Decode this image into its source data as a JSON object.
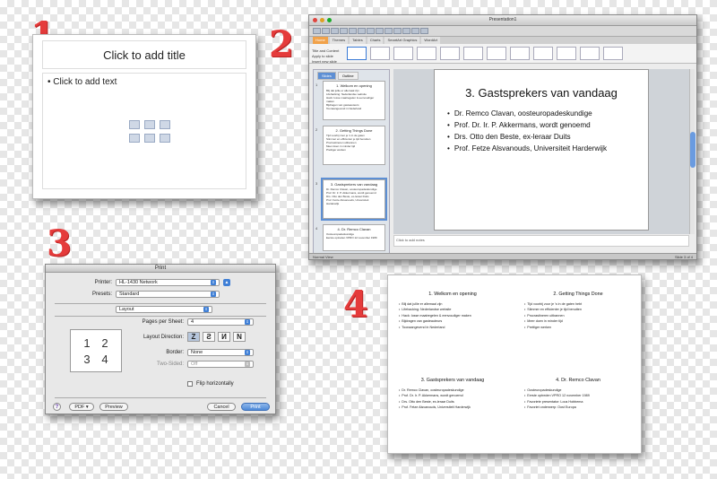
{
  "steps": [
    "1",
    "2",
    "3",
    "4"
  ],
  "empty_slide": {
    "title_placeholder": "Click to add title",
    "body_placeholder": "• Click to add text",
    "content_icons": [
      "table-icon",
      "chart-icon",
      "smartart-icon",
      "picture-icon",
      "clipart-icon",
      "media-icon"
    ]
  },
  "ppt_window": {
    "title": "Presentation1",
    "ribbon_tabs": [
      "Home",
      "Themes",
      "Tables",
      "Charts",
      "SmartArt Graphics",
      "WordArt"
    ],
    "ribbon_tag": [
      "Title and Content",
      "Apply to slide",
      "Insert new slide"
    ],
    "side_tabs": [
      "Slides",
      "Outline"
    ],
    "thumbnails": [
      {
        "num": "1",
        "title": "1. Welkom en opening",
        "lines": [
          "Blij dat jullie er allemaal zijn",
          "Lifehacking: Nederlandse website",
          "Hack: losse maatregelen & eenvoudiger maken",
          "Bijdragen van gasteauteurs",
          "Toonaangevend in Nederland"
        ]
      },
      {
        "num": "2",
        "title": "2. Getting Things Done",
        "lines": [
          "Tijd voorbij zoor je 's in de gaten",
          "Stimmer en efficienter je tijd benutten",
          "Procrastineren uitbannen",
          "Meer doen in minder tijd",
          "Prettiger werken"
        ]
      },
      {
        "num": "3",
        "title": "3. Gastsprekers van vandaag",
        "lines": [
          "Dr. Remco Clavan, oosteuropadeskundige",
          "Prof. Dr. Ir. P. Akkermans, wordt genoemd",
          "Drs. Otto den Beste, ex-leraar Duits",
          "Prof. Fetze Alsvanouds, Universiteit Harderwijk"
        ]
      },
      {
        "num": "4",
        "title": "4. Dr. Remco Clavan",
        "lines": [
          "Oosteuropadeskundige",
          "Eerste optreden VPRO 12 november 1989"
        ]
      }
    ],
    "slide": {
      "title": "3. Gastsprekers van vandaag",
      "bullets": [
        "Dr. Remco Clavan, oosteuropadeskundige",
        "Prof. Dr. Ir. P. Akkermans, wordt genoemd",
        "Drs. Otto den Beste, ex-leraar Duits",
        "Prof. Fetze Alsvanouds, Universiteit Harderwijk"
      ]
    },
    "notes_placeholder": "Click to add notes",
    "status_left": "Normal View",
    "status_right": "Slide 3 of 4"
  },
  "print_dialog": {
    "title": "Print",
    "printer_label": "Printer:",
    "printer_value": "HL-1430 Network",
    "presets_label": "Presets:",
    "presets_value": "Standard",
    "section_value": "Layout",
    "pages_label": "Pages per Sheet:",
    "pages_value": "4",
    "direction_label": "Layout Direction:",
    "border_label": "Border:",
    "border_value": "None",
    "twosided_label": "Two-Sided:",
    "twosided_value": "Off",
    "flip_label": "Flip horizontally",
    "preview_numbers": [
      "1",
      "2",
      "3",
      "4"
    ],
    "help_label": "?",
    "pdf_label": "PDF ▾",
    "preview_label": "Preview",
    "cancel_label": "Cancel",
    "print_label": "Print"
  },
  "handout": [
    {
      "title": "1. Welkom en opening",
      "lines": [
        "Blij dat jullie er allemaal zijn",
        "Lifehacking: Nederlandse website",
        "Hack: losse maatregelen & eenvoudiger maken",
        "Bijdragen van gasteauteurs",
        "Toonaangevend in Nederland"
      ]
    },
    {
      "title": "2. Getting Things Done",
      "lines": [
        "Tijd voorbij zoor je 's in de gaten hebt",
        "Slimmer en efficienter je tijd benutten",
        "Procrastineren uitbannen",
        "Meer doen in minder tijd",
        "Prettiger werken"
      ]
    },
    {
      "title": "3. Gastsprekers van vandaag",
      "lines": [
        "Dr. Remco Clavan, oosteuropadeskundige",
        "Prof. Dr. Ir. P. Akkermans, wordt genoemd",
        "Drs. Otto den Beste, ex-leraar Duits",
        "Prof. Fetze Alsvanouds, Universiteit Harderwijk"
      ]
    },
    {
      "title": "4. Dr. Remco Clavan",
      "lines": [
        "Oosteuropadeskundige",
        "Eerste optreden VPRO 12 november 1989",
        "Favoriete presentator: Lous Hobbema",
        "Favoriet onderwerp: Oost Europa"
      ]
    }
  ]
}
